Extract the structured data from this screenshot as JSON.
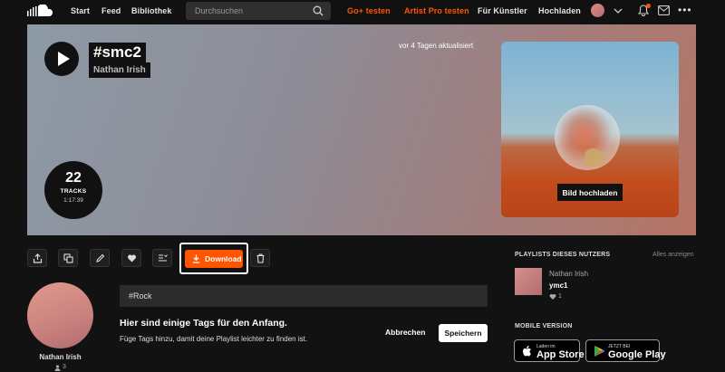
{
  "nav": {
    "start": "Start",
    "feed": "Feed",
    "library": "Bibliothek",
    "search_placeholder": "Durchsuchen",
    "go_plus": "Go+ testen",
    "artist_pro": "Artist Pro testen",
    "for_artists": "Für Künstler",
    "upload": "Hochladen"
  },
  "hero": {
    "title": "#smc2",
    "artist": "Nathan Irish",
    "updated": "vor 4 Tagen aktualisiert",
    "track_count": "22",
    "tracks_label": "TRACKS",
    "duration": "1:17:39",
    "upload_image": "Bild hochladen"
  },
  "actions": {
    "download": "Download"
  },
  "owner": {
    "name": "Nathan Irish",
    "followers": "3"
  },
  "tags": {
    "value": "#Rock",
    "heading": "Hier sind einige Tags für den Anfang.",
    "subtext": "Füge Tags hinzu, damit deine Playlist leichter zu finden ist.",
    "cancel": "Abbrechen",
    "save": "Speichern"
  },
  "sidebar": {
    "playlists_title": "PLAYLISTS DIESES NUTZERS",
    "show_all": "Alles anzeigen",
    "playlist": {
      "user": "Nathan Irish",
      "name": "ymc1",
      "likes": "1"
    },
    "mobile_title": "MOBILE VERSION",
    "appstore_small": "Laden im",
    "appstore_big": "App Store",
    "googleplay_small": "JETZT BEI",
    "googleplay_big": "Google Play"
  },
  "colors": {
    "accent": "#ff5500",
    "background": "#121212"
  }
}
